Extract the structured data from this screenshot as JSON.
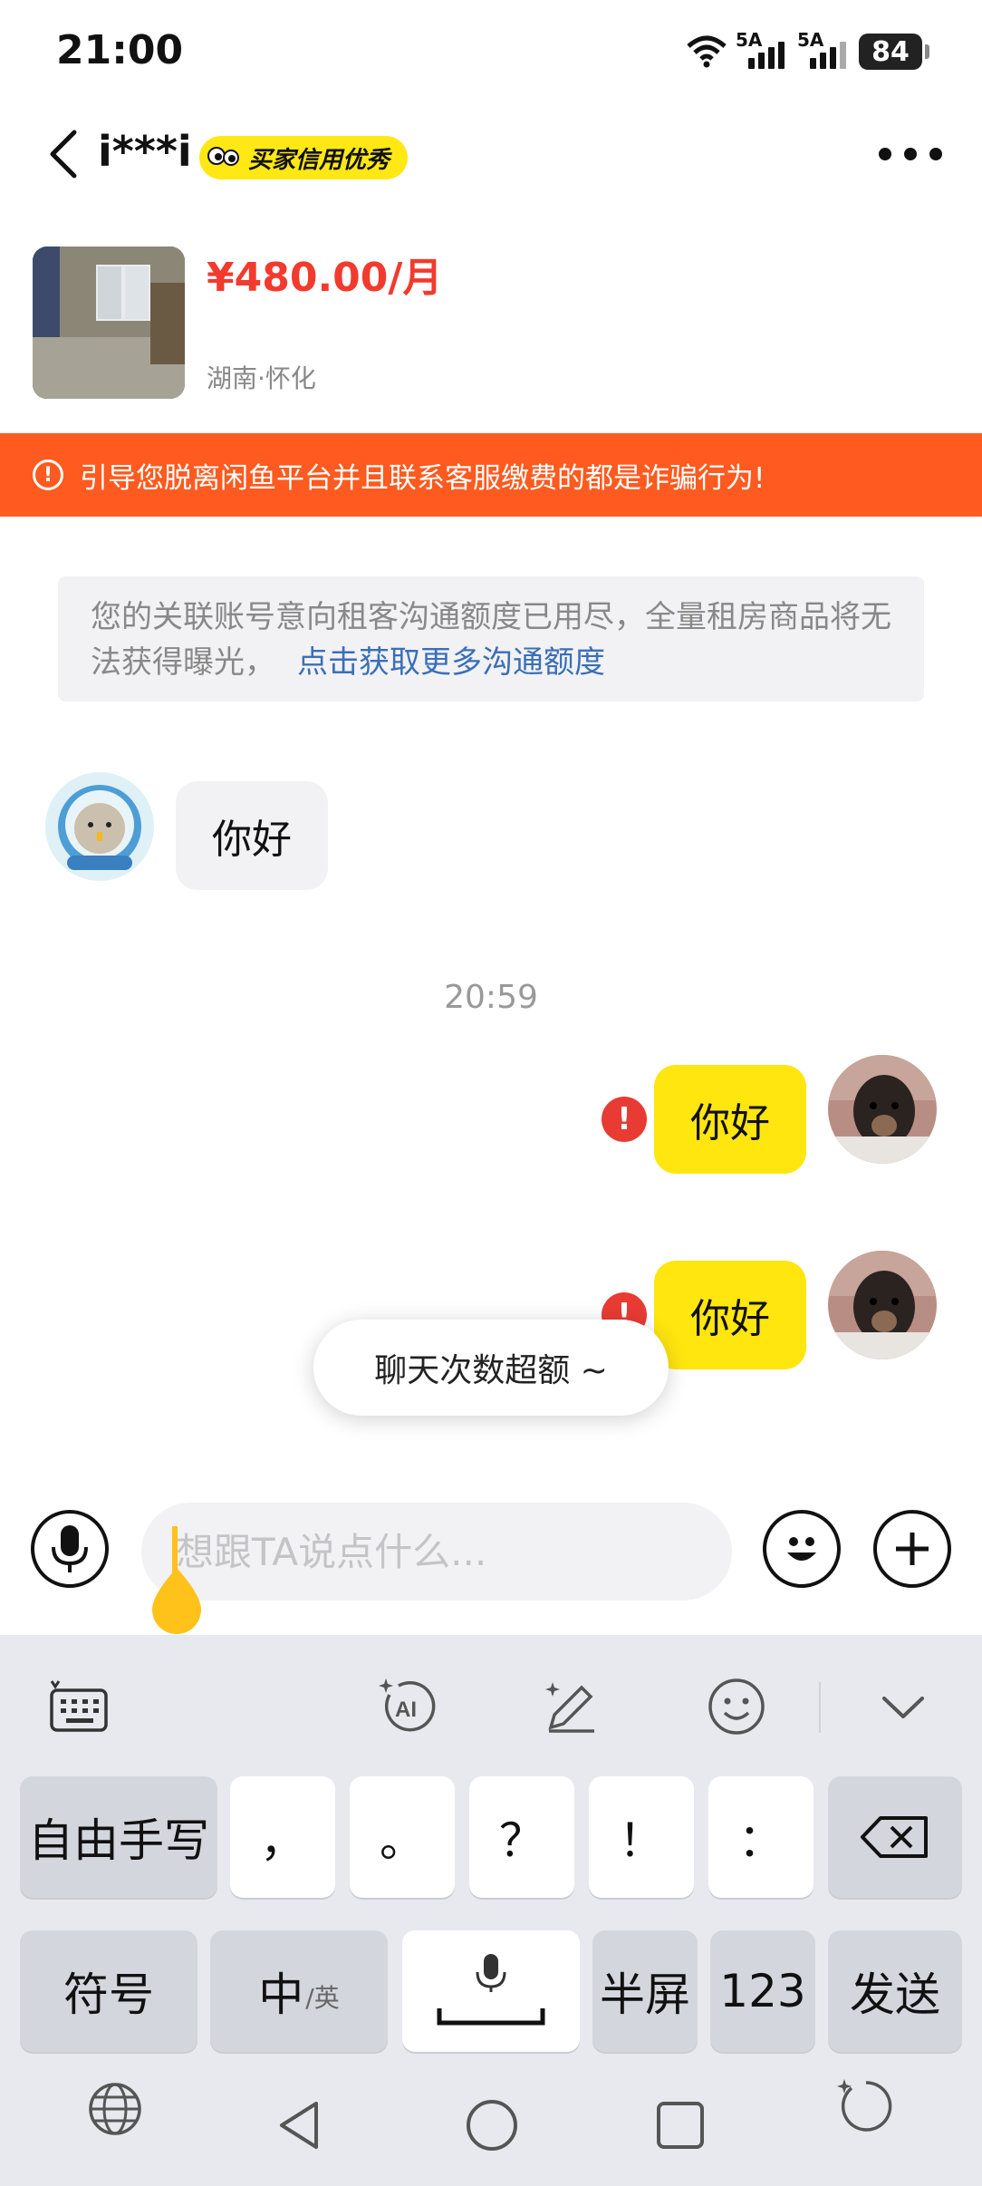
{
  "status_bar": {
    "time": "21:00",
    "signal1_label": "5A",
    "signal2_label": "5A",
    "battery": "84"
  },
  "header": {
    "peer_name": "i***i",
    "credit_badge": "买家信用优秀"
  },
  "product": {
    "price": "¥480.00/月",
    "location": "湖南·怀化"
  },
  "warning_banner": "引导您脱离闲鱼平台并且联系客服缴费的都是诈骗行为!",
  "quota_notice": {
    "text": "您的关联账号意向租客沟通额度已用尽，全量租房商品将无法获得曝光，",
    "link": "点击获取更多沟通额度"
  },
  "messages": {
    "incoming_1": "你好",
    "timestamp": "20:59",
    "outgoing_1": "你好",
    "outgoing_2": "你好",
    "error_mark": "!"
  },
  "toast": "聊天次数超额 ~",
  "input": {
    "placeholder": "想跟TA说点什么..."
  },
  "keyboard": {
    "row1": {
      "handwrite": "自由手写",
      "comma": "，",
      "period": "。",
      "question": "？",
      "exclaim": "！",
      "colon": "："
    },
    "row2": {
      "symbols": "符号",
      "lang_main": "中",
      "lang_sub": "/英",
      "half_screen": "半屏",
      "numbers": "123",
      "send": "发送"
    },
    "toolbar_icons": [
      "keyboard-settings-icon",
      "ai-icon",
      "handwrite-pen-icon",
      "emoji-icon",
      "collapse-icon"
    ]
  },
  "colors": {
    "price": "#f23a2e",
    "banner": "#ff5a1f",
    "bubble_out": "#ffe60f",
    "link": "#3a6fb8",
    "error": "#e83b34"
  }
}
